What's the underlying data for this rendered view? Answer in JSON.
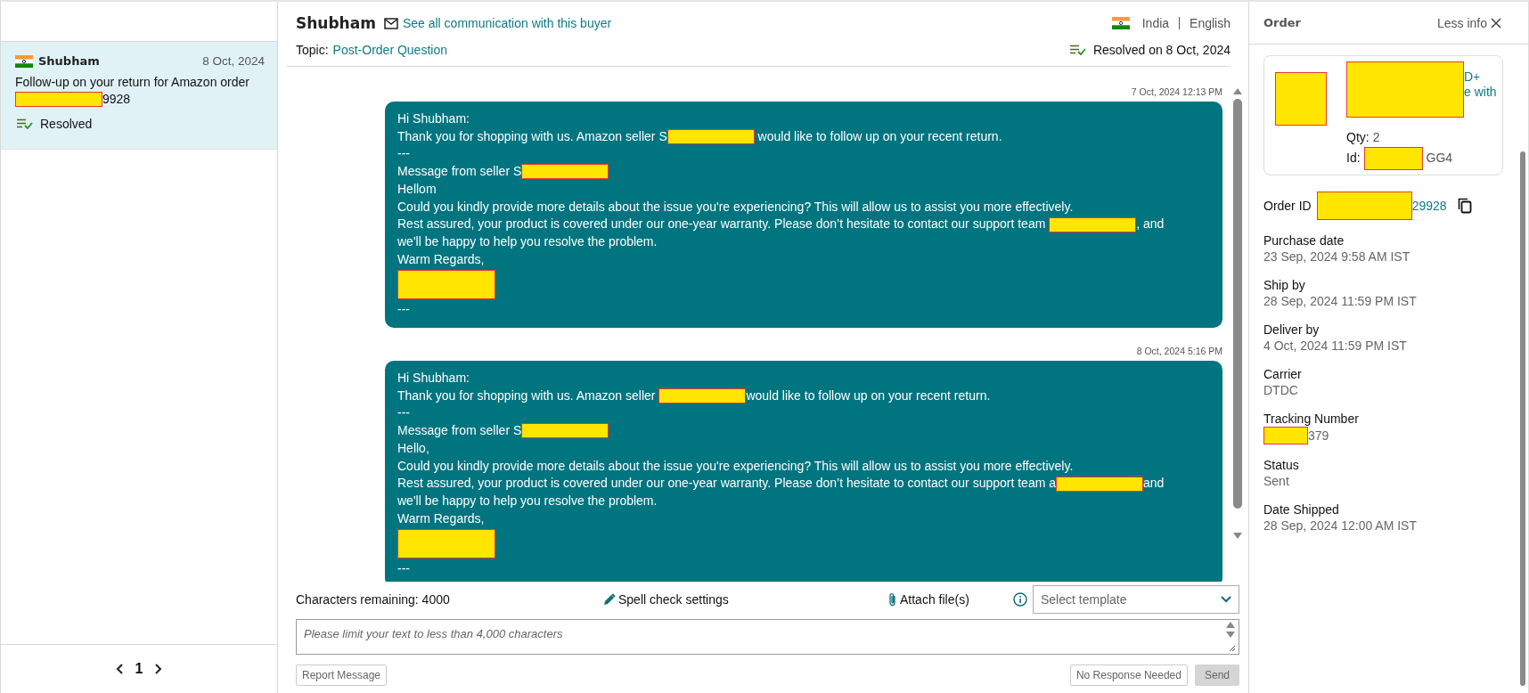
{
  "conversation_list": {
    "items": [
      {
        "name": "Shubham",
        "date": "8 Oct, 2024",
        "subject": [
          [
            {
              "kind": "text",
              "text": "Follow-up on your return for Amazon order"
            }
          ],
          [
            {
              "kind": "redaction"
            },
            {
              "kind": "text",
              "text": "9928"
            }
          ]
        ],
        "status": "Resolved",
        "selected": true
      }
    ],
    "pagination": {
      "page": "1"
    }
  },
  "thread": {
    "buyer": "Shubham",
    "communication_link": "See all communication with this buyer",
    "topic_label": "Topic:",
    "topic": "Post-Order Question",
    "country": "India",
    "language": "English",
    "resolved_text": "Resolved on 8 Oct, 2024",
    "messages": [
      {
        "timestamp": "7 Oct, 2024 12:13 PM",
        "lines": [
          [
            {
              "kind": "text",
              "text": "Hi Shubham:"
            }
          ],
          [
            {
              "kind": "text",
              "text": "Thank you for shopping with us. Amazon seller S"
            },
            {
              "kind": "redaction"
            },
            {
              "kind": "text",
              "text": " would like to follow up on your recent return."
            }
          ],
          [
            {
              "kind": "text",
              "text": "---"
            }
          ],
          [
            {
              "kind": "text",
              "text": "Message from seller S"
            },
            {
              "kind": "redaction"
            }
          ],
          [
            {
              "kind": "text",
              "text": "Hellom"
            }
          ],
          [
            {
              "kind": "text",
              "text": "Could you kindly provide more details about the issue you're experiencing? This will allow us to assist you more effectively."
            }
          ],
          [
            {
              "kind": "text",
              "text": "Rest assured, your product is covered under our one-year warranty. Please don’t hesitate to contact our support team "
            },
            {
              "kind": "redaction"
            },
            {
              "kind": "text",
              "text": ", and"
            }
          ],
          [
            {
              "kind": "text",
              "text": "we'll be happy to help you resolve the problem."
            }
          ],
          [
            {
              "kind": "text",
              "text": "Warm Regards,"
            }
          ],
          [
            {
              "kind": "block"
            }
          ],
          [
            {
              "kind": "text",
              "text": "---"
            }
          ]
        ]
      },
      {
        "timestamp": "8 Oct, 2024 5:16 PM",
        "lines": [
          [
            {
              "kind": "text",
              "text": "Hi Shubham:"
            }
          ],
          [
            {
              "kind": "text",
              "text": "Thank you for shopping with us. Amazon seller "
            },
            {
              "kind": "redaction"
            },
            {
              "kind": "text",
              "text": "would like to follow up on your recent return."
            }
          ],
          [
            {
              "kind": "text",
              "text": "---"
            }
          ],
          [
            {
              "kind": "text",
              "text": "Message from seller S"
            },
            {
              "kind": "redaction"
            }
          ],
          [
            {
              "kind": "text",
              "text": "Hello,"
            }
          ],
          [
            {
              "kind": "text",
              "text": "Could you kindly provide more details about the issue you're experiencing? This will allow us to assist you more effectively."
            }
          ],
          [
            {
              "kind": "text",
              "text": "Rest assured, your product is covered under our one-year warranty. Please don’t hesitate to contact our support team a"
            },
            {
              "kind": "redaction"
            },
            {
              "kind": "text",
              "text": "and"
            }
          ],
          [
            {
              "kind": "text",
              "text": "we'll be happy to help you resolve the problem."
            }
          ],
          [
            {
              "kind": "text",
              "text": "Warm Regards,"
            }
          ],
          [
            {
              "kind": "block"
            }
          ],
          [
            {
              "kind": "text",
              "text": "---"
            }
          ]
        ]
      }
    ]
  },
  "composer": {
    "characters_remaining": "Characters remaining: 4000",
    "spell_check": "Spell check settings",
    "attach": "Attach file(s)",
    "template_placeholder": "Select template",
    "message_placeholder": "Please limit your text to less than 4,000 characters",
    "report_button": "Report Message",
    "no_response_button": "No Response Needed",
    "send_button": "Send",
    "send_disabled": true
  },
  "order_panel": {
    "title": "Order",
    "less_info": "Less info",
    "product": {
      "title_lines": [
        "D+",
        "e with"
      ],
      "qty_label": "Qty:",
      "qty": "2",
      "id_label": "Id:",
      "id": [
        {
          "kind": "redaction"
        },
        {
          "kind": "text",
          "text": "GG4"
        }
      ]
    },
    "order_id_label": "Order ID",
    "order_id": [
      {
        "kind": "redaction"
      },
      {
        "kind": "text",
        "text": "29928"
      }
    ],
    "fields": [
      {
        "label": "Purchase date",
        "value": [
          {
            "kind": "text",
            "text": "23 Sep, 2024 9:58 AM IST"
          }
        ]
      },
      {
        "label": "Ship by",
        "value": [
          {
            "kind": "text",
            "text": "28 Sep, 2024 11:59 PM IST"
          }
        ]
      },
      {
        "label": "Deliver by",
        "value": [
          {
            "kind": "text",
            "text": "4 Oct, 2024 11:59 PM IST"
          }
        ]
      },
      {
        "label": "Carrier",
        "value": [
          {
            "kind": "text",
            "text": "DTDC"
          }
        ]
      },
      {
        "label": "Tracking Number",
        "value": [
          {
            "kind": "redaction"
          },
          {
            "kind": "text",
            "text": "379"
          }
        ]
      },
      {
        "label": "Status",
        "value": [
          {
            "kind": "text",
            "text": "Sent"
          }
        ]
      },
      {
        "label": "Date Shipped",
        "value": [
          {
            "kind": "text",
            "text": "28 Sep, 2024 12:00 AM IST"
          }
        ]
      }
    ]
  }
}
